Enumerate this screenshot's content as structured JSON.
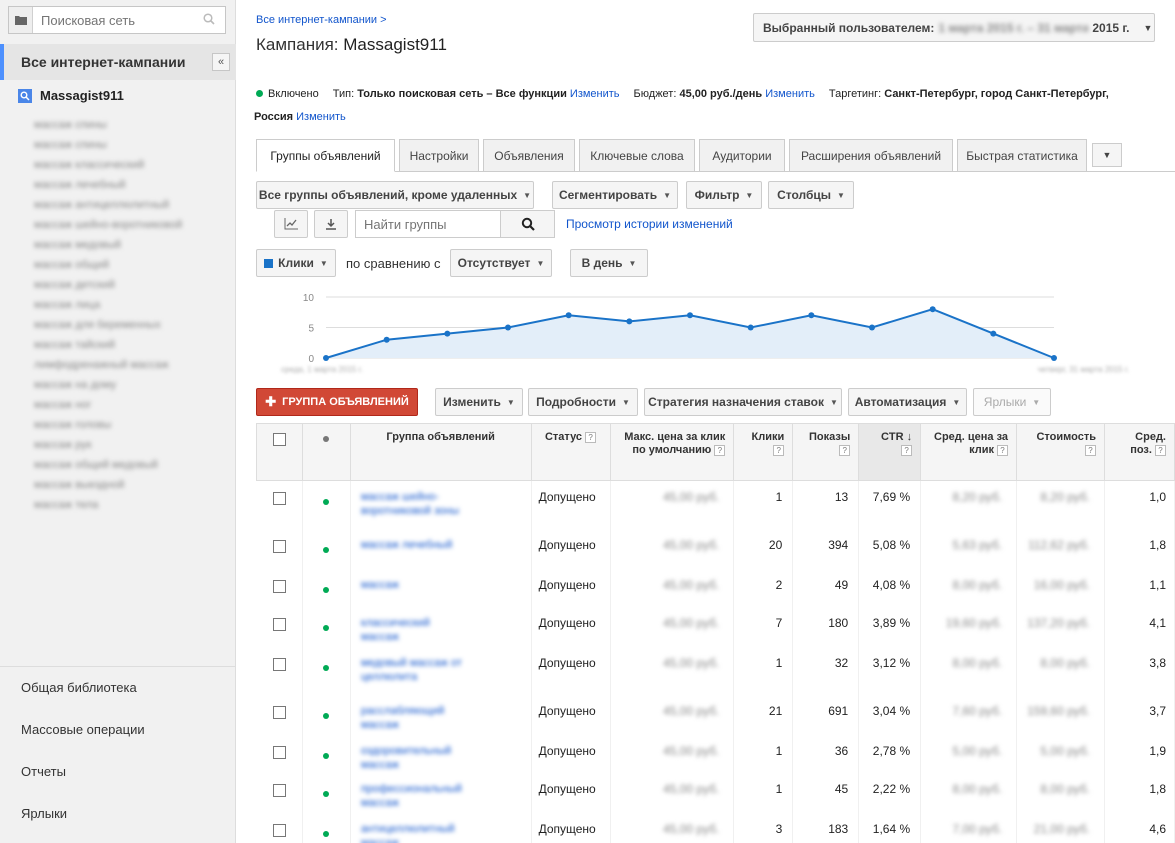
{
  "sidebar": {
    "search_placeholder": "Поисковая сеть",
    "all_campaigns": "Все интернет-кампании",
    "collapse": "«",
    "campaign": "Massagist911",
    "ad_groups": [
      "массаж спины",
      "массаж спины",
      "массаж классический",
      "массаж лечебный",
      "массаж антицеллюлитный",
      "массаж шейно-воротниковой",
      "массаж медовый",
      "массаж общий",
      "массаж детский",
      "массаж лица",
      "массаж для беременных",
      "массаж тайский",
      "лимфодренажный массаж",
      "массаж на дому",
      "массаж ног",
      "массаж головы",
      "массаж рук",
      "массаж общий медовый",
      "массаж выездной",
      "массаж тела"
    ],
    "bottom": [
      "Общая библиотека",
      "Массовые операции",
      "Отчеты",
      "Ярлыки"
    ]
  },
  "header": {
    "breadcrumb": "Все интернет-кампании >",
    "title_prefix": "Кампания:",
    "title_name": "Massagist911",
    "daterange_label": "Выбранный пользователем:",
    "daterange_hidden": "1 марта 2015 г. – 31 марта",
    "daterange_year": "2015 г."
  },
  "info": {
    "status": "Включено",
    "type_label": "Тип:",
    "type_value": "Только поисковая сеть – Все функции",
    "budget_label": "Бюджет:",
    "budget_value": "45,00 руб./день",
    "targeting_label": "Таргетинг:",
    "targeting_value": "Санкт-Петербург, город Санкт-Петербург,",
    "targeting_value2": "Россия",
    "change": "Изменить"
  },
  "tabs": [
    "Группы объявлений",
    "Настройки",
    "Объявления",
    "Ключевые слова",
    "Аудитории",
    "Расширения объявлений",
    "Быстрая статистика"
  ],
  "toolbar": {
    "filter_select": "Все группы объявлений, кроме удаленных",
    "segment": "Сегментировать",
    "filter": "Фильтр",
    "columns": "Столбцы",
    "search_placeholder": "Найти группы",
    "history_link": "Просмотр истории изменений",
    "metric": "Клики",
    "compare_label": "по сравнению с",
    "compare_value": "Отсутствует",
    "period": "В день"
  },
  "chart_data": {
    "type": "area",
    "y_ticks": [
      "10",
      "5",
      "0"
    ],
    "ylim": [
      0,
      10
    ],
    "x_start_label": "среда, 1 марта 2015 г.",
    "x_end_label": "четверг, 31 марта 2015 г.",
    "values": [
      0,
      3,
      4,
      5,
      7,
      6,
      7,
      5,
      7,
      5,
      8,
      4,
      0
    ],
    "color": "#1a73c8"
  },
  "actions": {
    "add_group": "ГРУППА ОБЪЯВЛЕНИЙ",
    "edit": "Изменить",
    "details": "Подробности",
    "bid_strategy": "Стратегия назначения ставок",
    "automation": "Автоматизация",
    "labels": "Ярлыки"
  },
  "table": {
    "columns": [
      "Группа объявлений",
      "Статус",
      "Макс. цена за клик по умолчанию",
      "Клики",
      "Показы",
      "CTR",
      "Сред. цена за клик",
      "Стоимость",
      "Сред. поз."
    ],
    "rows": [
      {
        "name": "массаж шейно-воротниковой зоны",
        "status": "Допущено",
        "bid": "45,00 руб.",
        "clicks": "1",
        "impr": "13",
        "ctr": "7,69 %",
        "cpc": "8,20 руб.",
        "cost": "8,20 руб.",
        "pos": "1,0"
      },
      {
        "name": "массаж лечебный",
        "status": "Допущено",
        "bid": "45,00 руб.",
        "clicks": "20",
        "impr": "394",
        "ctr": "5,08 %",
        "cpc": "5,63 руб.",
        "cost": "112,62 руб.",
        "pos": "1,8"
      },
      {
        "name": "массаж",
        "status": "Допущено",
        "bid": "45,00 руб.",
        "clicks": "2",
        "impr": "49",
        "ctr": "4,08 %",
        "cpc": "8,00 руб.",
        "cost": "16,00 руб.",
        "pos": "1,1"
      },
      {
        "name": "классический массаж",
        "status": "Допущено",
        "bid": "45,00 руб.",
        "clicks": "7",
        "impr": "180",
        "ctr": "3,89 %",
        "cpc": "19,60 руб.",
        "cost": "137,20 руб.",
        "pos": "4,1"
      },
      {
        "name": "медовый массаж от целлюлита",
        "status": "Допущено",
        "bid": "45,00 руб.",
        "clicks": "1",
        "impr": "32",
        "ctr": "3,12 %",
        "cpc": "8,00 руб.",
        "cost": "8,00 руб.",
        "pos": "3,8"
      },
      {
        "name": "расслабляющий массаж",
        "status": "Допущено",
        "bid": "45,00 руб.",
        "clicks": "21",
        "impr": "691",
        "ctr": "3,04 %",
        "cpc": "7,60 руб.",
        "cost": "159,60 руб.",
        "pos": "3,7"
      },
      {
        "name": "оздоровительный массаж",
        "status": "Допущено",
        "bid": "45,00 руб.",
        "clicks": "1",
        "impr": "36",
        "ctr": "2,78 %",
        "cpc": "5,00 руб.",
        "cost": "5,00 руб.",
        "pos": "1,9"
      },
      {
        "name": "профессиональный массаж",
        "status": "Допущено",
        "bid": "45,00 руб.",
        "clicks": "1",
        "impr": "45",
        "ctr": "2,22 %",
        "cpc": "8,00 руб.",
        "cost": "8,00 руб.",
        "pos": "1,8"
      },
      {
        "name": "антицеллюлитный массаж",
        "status": "Допущено",
        "bid": "45,00 руб.",
        "clicks": "3",
        "impr": "183",
        "ctr": "1,64 %",
        "cpc": "7,00 руб.",
        "cost": "21,00 руб.",
        "pos": "4,6"
      }
    ]
  }
}
